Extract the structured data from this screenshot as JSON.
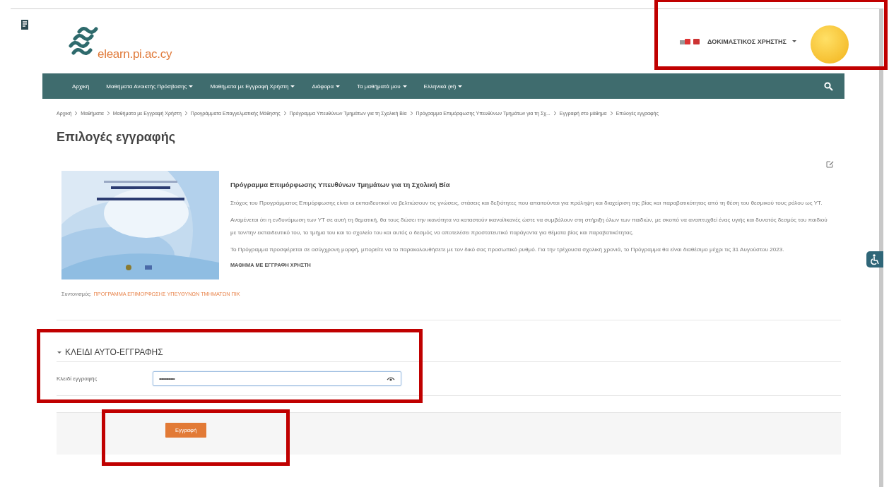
{
  "header": {
    "logo_text": "elearn.pi.ac.cy",
    "user_name": "ΔΟΚΙΜΑΣΤΙΚΟΣ ΧΡΗΣΤΗΣ",
    "highlighted": true
  },
  "nav": {
    "items": [
      {
        "label": "Αρχική",
        "dropdown": false
      },
      {
        "label": "Μαθήματα Ανοικτής Πρόσβασης",
        "dropdown": true
      },
      {
        "label": "Μαθήματα με Εγγραφή Χρήστη",
        "dropdown": true
      },
      {
        "label": "Διάφορα",
        "dropdown": true
      },
      {
        "label": "Τα μαθήματά μου",
        "dropdown": true
      },
      {
        "label": "Ελληνικά (el)",
        "dropdown": true
      }
    ]
  },
  "breadcrumb": [
    "Αρχική",
    "Μαθήματα",
    "Μαθήματα με Εγγραφή Χρήστη",
    "Προγράμματα Επαγγελματικής Μάθησης",
    "Πρόγραμμα Υπευθύνων Τμημάτων για τη Σχολική Βία",
    "Πρόγραμμα Επιμόρφωσης Υπευθύνων Τμημάτων για τη Σχ...",
    "Εγγραφή στο μάθημα",
    "Επιλογές εγγραφής"
  ],
  "page_title": "Επιλογές εγγραφής",
  "course": {
    "title": "Πρόγραμμα Επιμόρφωσης Υπευθύνων Τμημάτων για τη Σχολική Βία",
    "paragraphs": [
      "Στόχος του Προγράμματος Επιμόρφωσης είναι οι εκπαιδευτικοί να βελτιώσουν τις γνώσεις, στάσεις και δεξιότητες που απαιτούνται για πρόληψη και διαχείριση της βίας και παραβατικότητας από τη θέση του θεσμικού τους ρόλου ως ΥΤ.",
      "Αναμένεται ότι η ενδυνάμωση των ΥΤ σε αυτή τη θεματική, θα τους δώσει την ικανότητα να καταστούν ικανοί/ικανές ώστε να συμβάλουν στη στήριξη όλων των παιδιών, με σκοπό να αναπτυχθεί ένας υγιής και δυνατός δεσμός του παιδιού με τον/την εκπαιδευτικό του, το τμήμα του και το σχολείο του και αυτός ο δεσμός να αποτελέσει προστατευτικό παράγοντα για θέματα βίας και παραβατικότητας.",
      "Το Πρόγραμμα προσφέρεται σε ασύγχρονη μορφή, μπορείτε να το παρακολουθήσετε με τον δικό σας προσωπικό ρυθμό. Για την τρέχουσα σχολική χρονιά, το Πρόγραμμα θα είναι διαθέσιμο μέχρι τις 31 Αυγούστου 2023."
    ],
    "category": "ΜΑΘΗΜΑ ΜΕ ΕΓΓΡΑΦΗ ΧΡΗΣΤΗ",
    "contact_label": "Συντονισμός:",
    "contact_value": "ΠΡΟΓΡΑΜΜΑ ΕΠΙΜΟΡΦΩΣΗΣ ΥΠΕΥΘΥΝΩΝ ΤΜΗΜΑΤΩΝ ΠΙΚ"
  },
  "enrolment": {
    "section_title": "ΚΛΕΙΔΙ ΑΥΤΟ-ΕΓΓΡΑΦΗΣ",
    "expanded": true,
    "highlighted": true,
    "field_label": "Κλειδί εγγραφής",
    "value": "•••••••••••••••",
    "button": "Εγγραφή",
    "button_highlighted": true
  }
}
